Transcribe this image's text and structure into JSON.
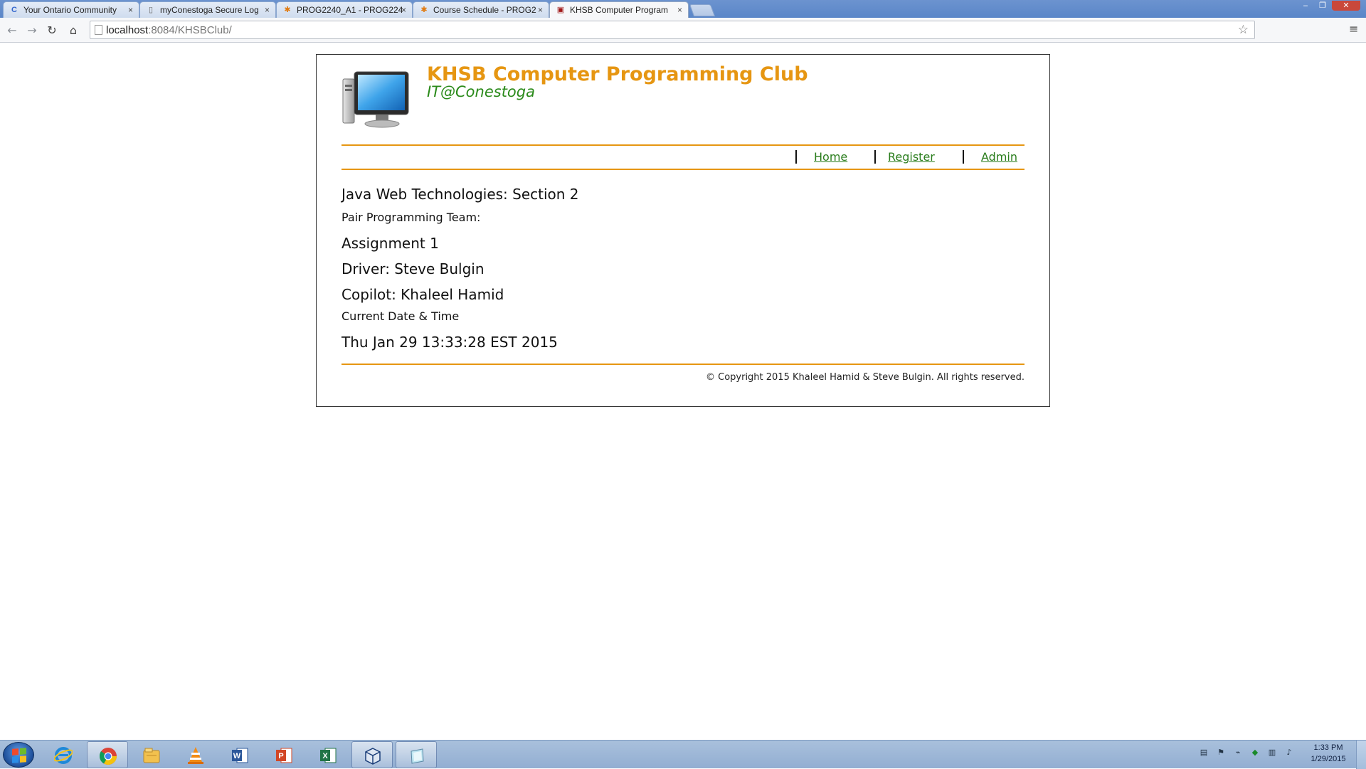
{
  "browser": {
    "tabs": [
      {
        "label": "Your Ontario Community",
        "favicon": "C"
      },
      {
        "label": "myConestoga Secure Log",
        "favicon": "▯"
      },
      {
        "label": "PROG2240_A1 - PROG224",
        "favicon": "✱"
      },
      {
        "label": "Course Schedule - PROG2",
        "favicon": "✱"
      },
      {
        "label": "KHSB Computer Program",
        "favicon": "▣"
      }
    ],
    "tab_close_glyph": "×",
    "url_host": "localhost",
    "url_rest": ":8084/KHSBClub/"
  },
  "site": {
    "title": "KHSB Computer Programming Club",
    "subtitle": "IT@Conestoga",
    "title_color": "#e69612",
    "subtitle_color": "#2a8a1a",
    "nav": {
      "home": "Home",
      "register": "Register",
      "admin": "Admin"
    },
    "content": {
      "course": "Java Web Technologies: Section 2",
      "team_label": "Pair Programming Team:",
      "assignment": "Assignment 1",
      "driver": "Driver: Steve Bulgin",
      "copilot": "Copilot: Khaleel Hamid",
      "datetime_label": "Current Date & Time",
      "datetime": "Thu Jan 29 13:33:28 EST 2015"
    },
    "footer": "© Copyright 2015 Khaleel Hamid & Steve Bulgin. All rights reserved."
  },
  "taskbar": {
    "apps": [
      "internet-explorer-icon",
      "chrome-icon",
      "file-explorer-icon",
      "vlc-icon",
      "word-icon",
      "powerpoint-icon",
      "excel-icon",
      "virtualbox-icon",
      "notepad-icon"
    ],
    "clock_time": "1:33 PM",
    "clock_date": "1/29/2015"
  }
}
